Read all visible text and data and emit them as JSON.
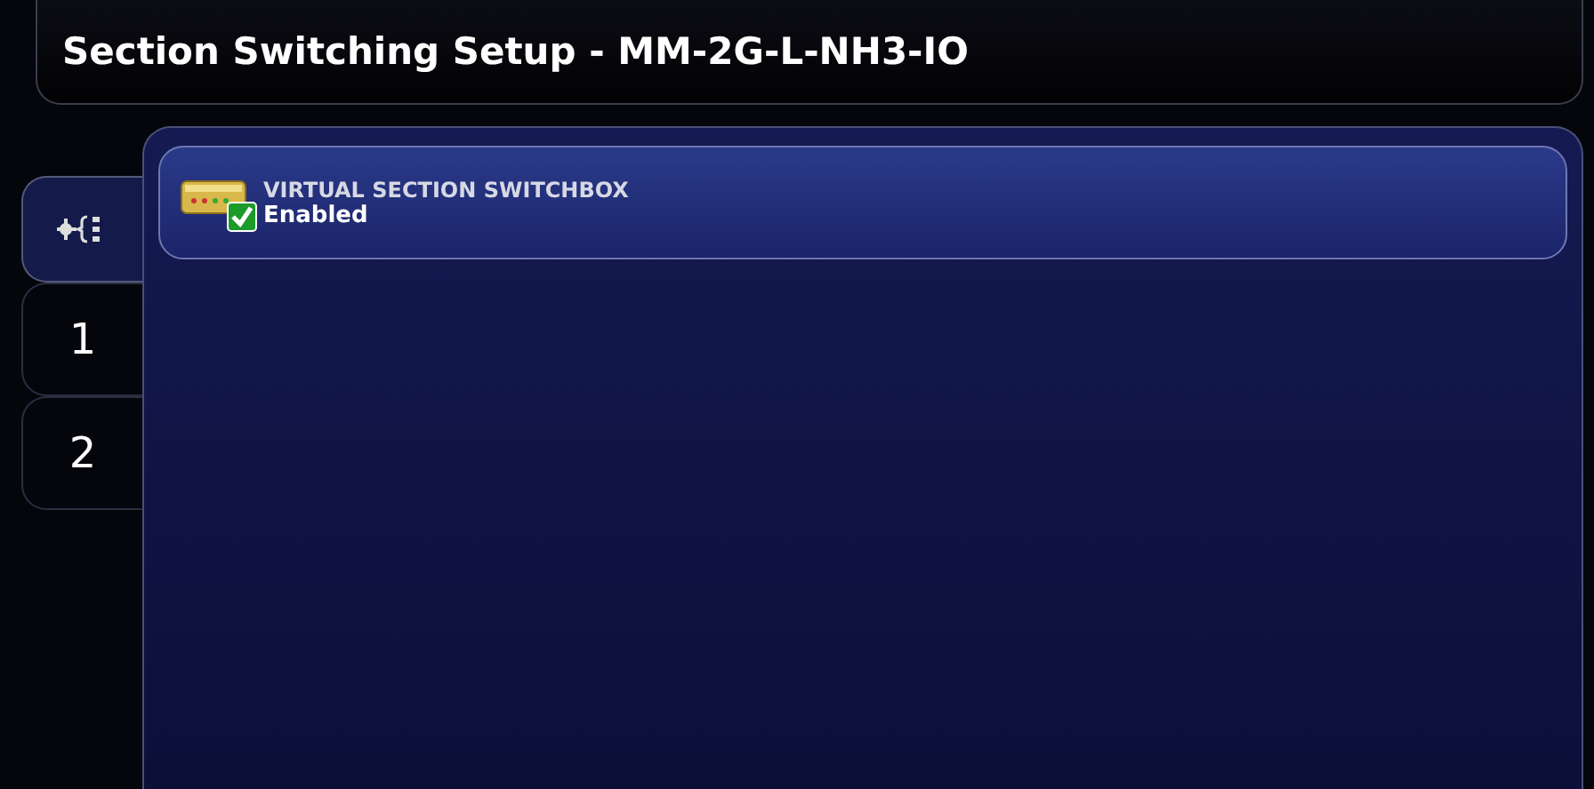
{
  "window": {
    "title": "Section Switching Setup - MM-2G-L-NH3-IO"
  },
  "tabs": [
    {
      "kind": "icon",
      "selected": true
    },
    {
      "kind": "text",
      "label": "1",
      "selected": false
    },
    {
      "kind": "text",
      "label": "2",
      "selected": false
    }
  ],
  "items": [
    {
      "title": "VIRTUAL SECTION SWITCHBOX",
      "status": "Enabled",
      "checked": true
    }
  ]
}
